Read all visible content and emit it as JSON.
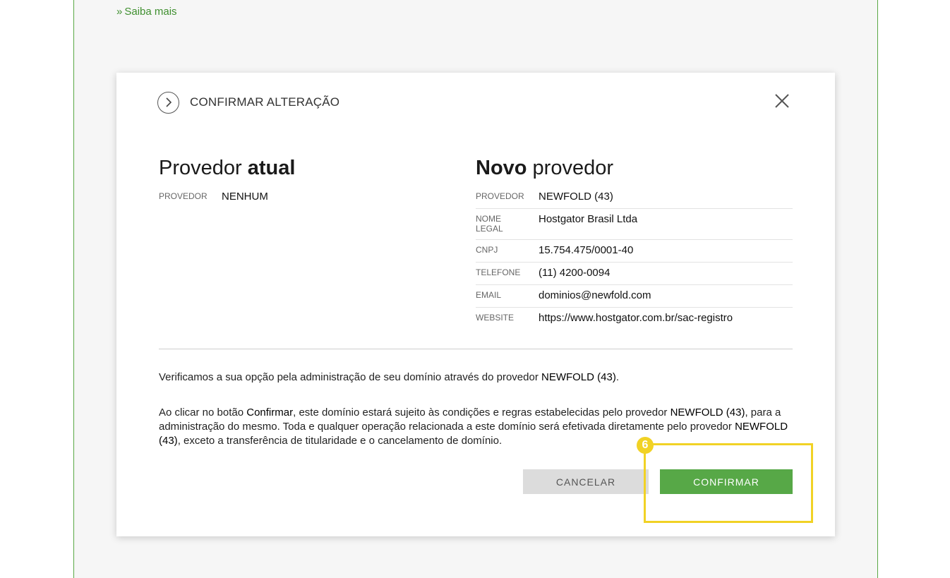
{
  "page": {
    "saiba_mais_prefix": "»",
    "saiba_mais": "Saiba mais"
  },
  "modal": {
    "title": "CONFIRMAR ALTERAÇÃO",
    "current": {
      "heading_light": "Provedor ",
      "heading_bold": "atual",
      "rows": [
        {
          "label": "PROVEDOR",
          "value": "NENHUM"
        }
      ]
    },
    "new": {
      "heading_bold": "Novo",
      "heading_light": " provedor",
      "rows": [
        {
          "label": "PROVEDOR",
          "value": "NEWFOLD (43)"
        },
        {
          "label": "NOME LEGAL",
          "value": "Hostgator Brasil Ltda"
        },
        {
          "label": "CNPJ",
          "value": "15.754.475/0001-40"
        },
        {
          "label": "TELEFONE",
          "value": "(11) 4200-0094"
        },
        {
          "label": "EMAIL",
          "value": "dominios@newfold.com"
        },
        {
          "label": "WEBSITE",
          "value": "https://www.hostgator.com.br/sac-registro"
        }
      ]
    },
    "paragraph1": {
      "text": "Verificamos a sua opção pela administração de seu domínio através do provedor ",
      "provider": "NEWFOLD (43)",
      "end": "."
    },
    "paragraph2": {
      "t1": "Ao clicar no botão ",
      "confirm_word": "Confirmar",
      "t2": ", este domínio estará sujeito às condições e regras estabelecidas pelo provedor ",
      "provider1": "NEWFOLD (43)",
      "t3": ", para a administração do mesmo. Toda e qualquer operação relacionada a este domínio será efetivada diretamente pelo provedor ",
      "provider2": "NEWFOLD (43)",
      "t4": ", exceto a transferência de titularidade e o cancelamento de domínio."
    },
    "buttons": {
      "cancel": "CANCELAR",
      "confirm": "CONFIRMAR"
    }
  },
  "annotation": {
    "step_number": "6",
    "color": "#f1d225"
  },
  "colors": {
    "accent_green": "#57a847",
    "link_green": "#3f8f2f"
  }
}
